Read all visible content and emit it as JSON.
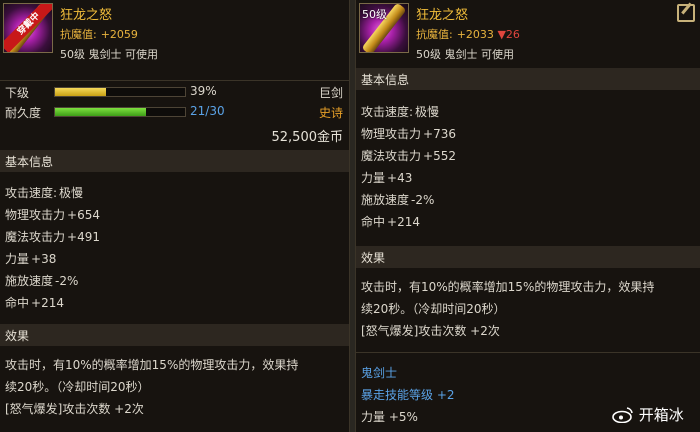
{
  "left": {
    "name": "狂龙之怒",
    "badge": "穿戴中",
    "resist_label": "抗魔值:",
    "resist_value": "+2059",
    "requirement": "50级 鬼剑士 可使用",
    "grade_label": "下级",
    "grade_percent": "39%",
    "grade_fill": 0.39,
    "type": "巨剑",
    "durability_label": "耐久度",
    "durability_value": "21/30",
    "durability_fill": 0.7,
    "rarity": "史诗",
    "price": "52,500金币",
    "basic_title": "基本信息",
    "stats": [
      {
        "label": "攻击速度:",
        "value": "极慢"
      },
      {
        "label": "物理攻击力",
        "value": "+654"
      },
      {
        "label": "魔法攻击力",
        "value": "+491"
      },
      {
        "label": "力量",
        "value": "+38"
      },
      {
        "label": "施放速度",
        "value": "-2%"
      },
      {
        "label": "命中",
        "value": "+214"
      }
    ],
    "effect_title": "效果",
    "effect_line1": "攻击时，有10%的概率增加15%的物理攻击力，效果持",
    "effect_line2": "续20秒。（冷却时间20秒）",
    "effect_line3": "[怒气爆发]攻击次数 +2次"
  },
  "right": {
    "level_tag": "50级",
    "name": "狂龙之怒",
    "resist_label": "抗魔值:",
    "resist_value": "+2033",
    "resist_diff": "▼26",
    "requirement": "50级 鬼剑士 可使用",
    "basic_title": "基本信息",
    "stats": [
      {
        "label": "攻击速度:",
        "value": "极慢"
      },
      {
        "label": "物理攻击力",
        "value": "+736"
      },
      {
        "label": "魔法攻击力",
        "value": "+552"
      },
      {
        "label": "力量",
        "value": "+43"
      },
      {
        "label": "施放速度",
        "value": "-2%"
      },
      {
        "label": "命中",
        "value": "+214"
      }
    ],
    "effect_title": "效果",
    "effect_line1": "攻击时，有10%的概率增加15%的物理攻击力，效果持",
    "effect_line2": "续20秒。（冷却时间20秒）",
    "effect_line3": "[怒气爆发]攻击次数 +2次",
    "class_title": "鬼剑士",
    "skill_bonus": "暴走技能等级 +2",
    "strength_bonus": "力量 +5%"
  },
  "watermark": {
    "icon": "weibo-icon",
    "text": "开箱冰"
  },
  "colors": {
    "gold": "#f1bd3a",
    "blue": "#5aa2e6",
    "red": "#e0463e",
    "orange": "#e8a028"
  }
}
